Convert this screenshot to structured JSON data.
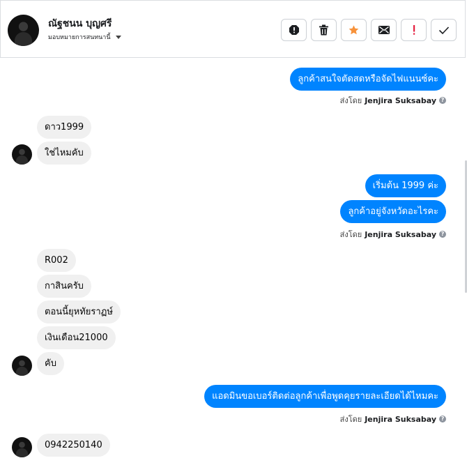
{
  "header": {
    "name": "ณัฐชนน บุญศรี",
    "assign_label": "มอบหมายการสนทนานี้",
    "actions": [
      {
        "name": "report-icon-button",
        "icon": "exclamation-circle-icon"
      },
      {
        "name": "delete-button",
        "icon": "trash-icon"
      },
      {
        "name": "star-button",
        "icon": "star-icon"
      },
      {
        "name": "mark-unread-button",
        "icon": "envelope-icon"
      },
      {
        "name": "follow-up-button",
        "icon": "exclamation-icon"
      },
      {
        "name": "done-button",
        "icon": "check-icon"
      }
    ]
  },
  "messages": [
    {
      "dir": "out",
      "text": "ลูกค้าสนใจตัดสดหรือจัดไฟแนนซ์คะ"
    },
    {
      "dir": "in",
      "text": "ดาว1999"
    },
    {
      "dir": "in",
      "text": "ใช่ไหมคับ"
    },
    {
      "dir": "out",
      "text": "เริ่มต้น 1999 ค่ะ"
    },
    {
      "dir": "out",
      "text": "ลูกค้าอยู่จังหวัดอะไรคะ"
    },
    {
      "dir": "in",
      "text": "R002"
    },
    {
      "dir": "in",
      "text": "กาสินครับ"
    },
    {
      "dir": "in",
      "text": "ตอนนี้ยุหทัยราฏษ์"
    },
    {
      "dir": "in",
      "text": "เงินเดือน21000"
    },
    {
      "dir": "in",
      "text": "คับ"
    },
    {
      "dir": "out",
      "text": "แอดมินขอเบอร์ติดต่อลูกค้าเพื่อพูดคุยรายละเอียดได้ไหมคะ"
    },
    {
      "dir": "in",
      "text": "0942250140"
    }
  ],
  "sent_by": {
    "prefix": "ส่งโดย",
    "agent": "Jenjira Suksabay"
  },
  "colors": {
    "outgoing": "#0084ff",
    "incoming": "#f0f0f0",
    "star": "#f7923a",
    "alert": "#e41e3f"
  }
}
